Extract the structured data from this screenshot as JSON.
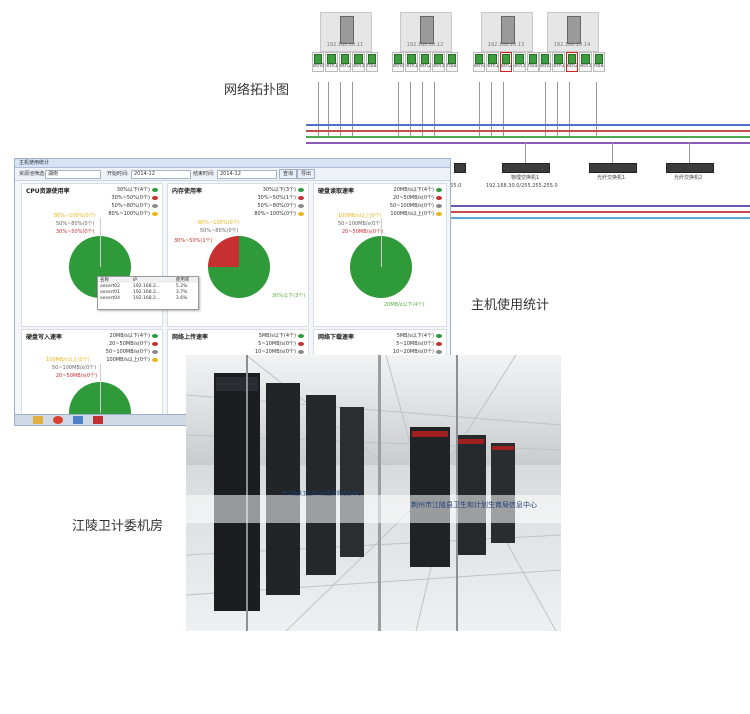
{
  "captions": {
    "topology": "网络拓扑图",
    "host_usage": "主机使用统计",
    "machine_room": "江陵卫计委机房"
  },
  "topology": {
    "servers": [
      {
        "ip": "192.168.20.11",
        "ports": [
          "eth0",
          "eth1",
          "eth2",
          "eth3",
          "hba"
        ]
      },
      {
        "ip": "192.168.20.12",
        "ports": [
          "eth0",
          "eth1",
          "eth2",
          "eth3",
          "hba"
        ]
      },
      {
        "ip": "192.168.20.13",
        "ports": [
          "eth0",
          "eth1",
          "eth2",
          "eth3",
          "hba"
        ]
      },
      {
        "ip": "192.168.20.14",
        "ports": [
          "eth0",
          "eth1",
          "eth2",
          "eth3",
          "hba"
        ]
      }
    ],
    "switches": [
      {
        "name": "物理交换机1",
        "ip": "192.168.30.0/255.255.255.0"
      },
      {
        "name": "光纤交换机1",
        "ip": ""
      },
      {
        "name": "光纤交换机2",
        "ip": ""
      }
    ],
    "partial_label": "255.0"
  },
  "app": {
    "title": "主机使用统计",
    "toolbar": {
      "range_label": "资源池筛选:",
      "range_value": "湖南",
      "start_label": "开始时间:",
      "start_value": "2014-12",
      "end_label": "结束时间:",
      "end_value": "2014-12",
      "query_btn": "查询",
      "export_btn": "导出"
    },
    "panels": [
      {
        "title": "CPU资源使用率",
        "legend": [
          "30%以下(4个)",
          "30%~50%(0个)",
          "50%~80%(0个)",
          "80%~100%(0个)"
        ],
        "labels": [
          "80%~100%(0个)",
          "50%~80%(0个)",
          "30%~50%(0个)"
        ]
      },
      {
        "title": "内存使用率",
        "legend": [
          "30%以下(3个)",
          "30%~50%(1个)",
          "50%~80%(0个)",
          "80%~100%(0个)"
        ],
        "labels": [
          "80%~100%(0个)",
          "50%~80%(0个)",
          "30%~50%(1个)",
          "30%以下(3个)"
        ]
      },
      {
        "title": "硬盘读取速率",
        "legend": [
          "20MB/s以下(4个)",
          "20~50MB/s(0个)",
          "50~100MB/s(0个)",
          "100MB/s以上(0个)"
        ],
        "labels": [
          "100MB/s以上(0个)",
          "50~100MB/s(0个)",
          "20~50MB/s(0个)",
          "20MB/s以下(4个)"
        ]
      },
      {
        "title": "硬盘写入速率",
        "legend": [
          "20MB/s以下(4个)",
          "20~50MB/s(0个)",
          "50~100MB/s(0个)",
          "100MB/s以上(0个)"
        ],
        "labels": [
          "100MB/s以上(0个)",
          "50~100MB/s(0个)",
          "20~50MB/s(0个)"
        ]
      },
      {
        "title": "网络上传速率",
        "legend": [
          "5MB/s以下(4个)",
          "5~10MB/s(0个)",
          "10~20MB/s(0个)"
        ],
        "labels": []
      },
      {
        "title": "网络下载速率",
        "legend": [
          "5MB/s以下(4个)",
          "5~10MB/s(0个)",
          "10~20MB/s(0个)"
        ],
        "labels": []
      }
    ],
    "tooltip": {
      "headers": [
        "名称",
        "IP",
        "使用率"
      ],
      "rows": [
        [
          "oesert02",
          "192.168.2...",
          "5.2%"
        ],
        [
          "oesert01",
          "192.168.2...",
          "3.7%"
        ],
        [
          "oesert04",
          "192.168.2...",
          "3.6%"
        ]
      ]
    }
  },
  "photo": {
    "banner_left": "市江陵县卫生和计划生育局信息中心",
    "banner_right": "荆州市江陵县卫生和计划生育局信息中心"
  },
  "colors": {
    "green": "#2e9a3a",
    "red": "#c63030",
    "gray": "#8a8a8a",
    "yellow": "#e8b61c",
    "lime": "#5aae3c"
  }
}
